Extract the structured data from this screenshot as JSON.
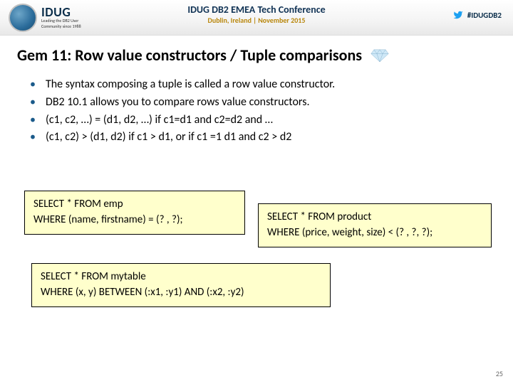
{
  "header": {
    "org": "IDUG",
    "org_sub1": "Leading the DB2 User",
    "org_sub2": "Community since 1988",
    "conf_main": "IDUG DB2 EMEA Tech Conference",
    "conf_sub": "Dublin, Ireland  |  November 2015",
    "hashtag": "#IDUGDB2"
  },
  "title": "Gem 11: Row value constructors / Tuple comparisons",
  "bullets": [
    "The syntax composing a tuple is called a row value constructor.",
    "DB2 10.1 allows you to compare rows value constructors.",
    "(c1, c2, …) = (d1, d2, …)  if c1=d1 and c2=d2 and …",
    "(c1, c2) > (d1, d2)  if  c1 > d1, or if c1 =1 d1 and c2 > d2"
  ],
  "code": {
    "a1": "SELECT * FROM emp",
    "a2": "WHERE (name, firstname) = (? , ?);",
    "b1": "SELECT * FROM product",
    "b2": "WHERE (price, weight, size) <  (? , ?, ?);",
    "c1": "SELECT * FROM mytable",
    "c2": "WHERE (x, y) BETWEEN (:x1, :y1)  AND (:x2, :y2)"
  },
  "page": "25"
}
